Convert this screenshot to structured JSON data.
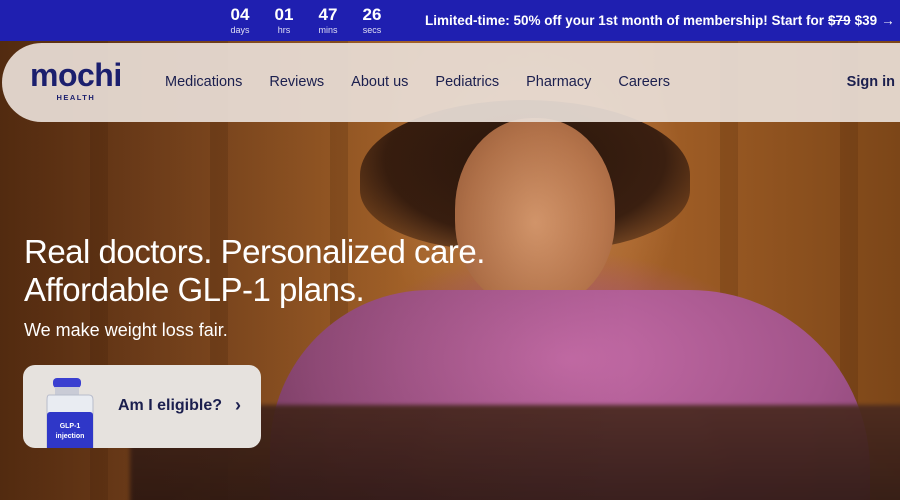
{
  "promo": {
    "timer": [
      {
        "value": "04",
        "unit": "days"
      },
      {
        "value": "01",
        "unit": "hrs"
      },
      {
        "value": "47",
        "unit": "mins"
      },
      {
        "value": "26",
        "unit": "secs"
      }
    ],
    "text_prefix": "Limited-time: 50% off your 1st month of membership! Start for",
    "old_price": "$79",
    "new_price": "$39",
    "arrow": "→",
    "bg_color": "#1f1fb0"
  },
  "nav": {
    "logo_text": "mochi",
    "logo_sub": "HEALTH",
    "links": [
      "Medications",
      "Reviews",
      "About us",
      "Pediatrics",
      "Pharmacy",
      "Careers"
    ],
    "signin": "Sign in"
  },
  "hero": {
    "headline_line1": "Real doctors. Personalized care.",
    "headline_line2": "Affordable GLP-1 plans.",
    "subhead": "We make weight loss fair.",
    "cta_label": "Am I eligible?",
    "cta_icon": "chevron-right-icon",
    "vial_text_1": "GLP-1",
    "vial_text_2": "injection"
  }
}
